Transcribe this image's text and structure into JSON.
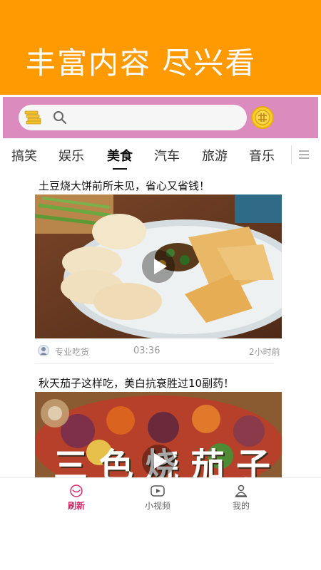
{
  "banner": {
    "title": "丰富内容 尽兴看",
    "background": "#ff9a03"
  },
  "search": {
    "placeholder": "",
    "bar_color": "#dc8bbf"
  },
  "tabs": [
    "搞笑",
    "娱乐",
    "美食",
    "汽车",
    "旅游",
    "音乐"
  ],
  "active_tab": "美食",
  "feed": [
    {
      "title": "土豆烧大饼前所未见，省心又省钱！",
      "source": "专业吃货",
      "duration": "03:36",
      "time_ago": "2小时前"
    },
    {
      "title": "秋天茄子这样吃，美白抗衰胜过10副药！",
      "overlay_text": "三色烧茄子"
    }
  ],
  "bottom_nav": [
    {
      "label": "刷新",
      "icon": "refresh-icon",
      "active": true
    },
    {
      "label": "小视频",
      "icon": "video-icon",
      "active": false
    },
    {
      "label": "我的",
      "icon": "profile-icon",
      "active": false
    }
  ],
  "colors": {
    "accent": "#d5286a",
    "banner": "#ff9a03",
    "search_bar": "#dc8bbf"
  }
}
